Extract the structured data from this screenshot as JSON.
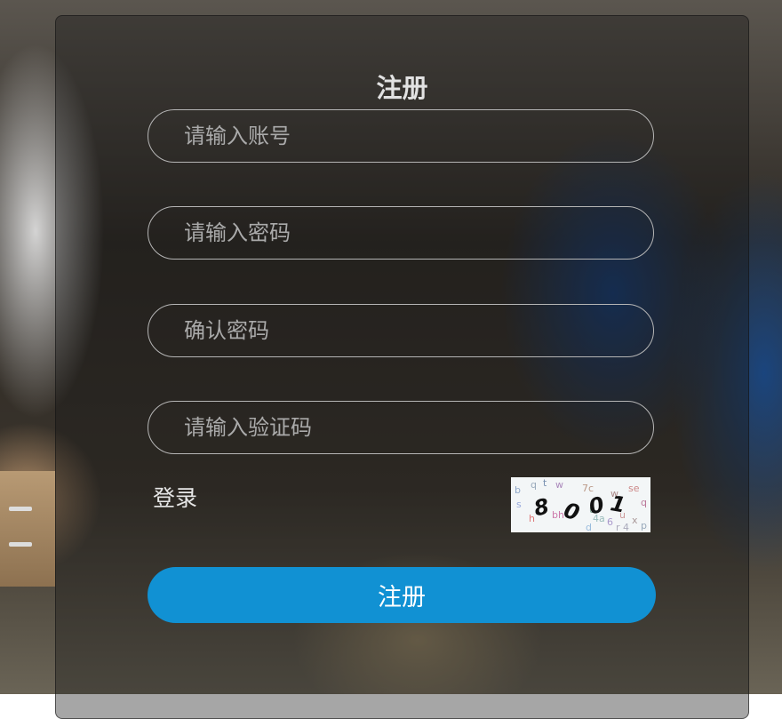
{
  "form": {
    "title": "注册",
    "account_placeholder": "请输入账号",
    "password_placeholder": "请输入密码",
    "confirm_placeholder": "确认密码",
    "captcha_placeholder": "请输入验证码",
    "login_link": "登录",
    "submit_label": "注册"
  },
  "captcha": {
    "code": "8001"
  },
  "colors": {
    "primary_button": "#1191d3",
    "field_border": "#b5b5b5"
  }
}
